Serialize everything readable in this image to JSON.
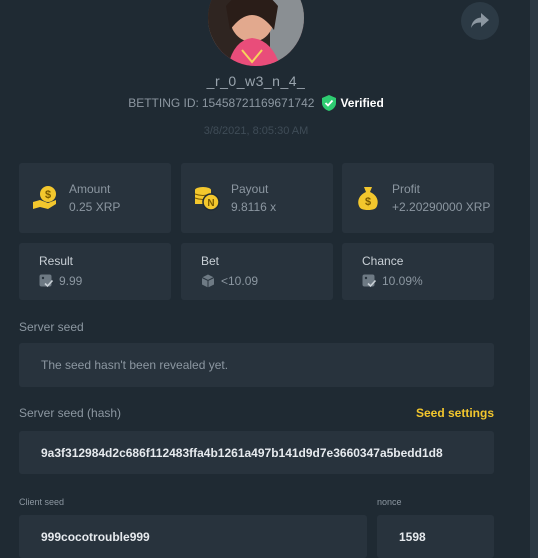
{
  "profile": {
    "username": "_r_0_w3_n_4_",
    "bet_id_label": "BETTING ID:",
    "bet_id": "15458721169671742",
    "verified_label": "Verified",
    "date": "3/8/2021, 8:05:30 AM"
  },
  "stats": [
    {
      "label": "Amount",
      "value": "0.25 XRP",
      "icon": "coin-hand-icon"
    },
    {
      "label": "Payout",
      "value": "9.8116 x",
      "icon": "coin-stack-icon"
    },
    {
      "label": "Profit",
      "value": "+2.20290000 XRP",
      "icon": "money-bag-icon"
    }
  ],
  "details": [
    {
      "label": "Result",
      "value": "9.99",
      "icon": "dice-check-icon"
    },
    {
      "label": "Bet",
      "value": "<10.09",
      "icon": "dice-icon"
    },
    {
      "label": "Chance",
      "value": "10.09%",
      "icon": "dice-check-icon"
    }
  ],
  "server_seed": {
    "label": "Server seed",
    "message": "The seed hasn't been revealed yet."
  },
  "server_seed_hash": {
    "label": "Server seed (hash)",
    "settings_label": "Seed settings",
    "value": "9a3f312984d2c686f112483ffa4b1261a497b141d9d7e3660347a5bedd1d8"
  },
  "client": {
    "seed_label": "Client seed",
    "seed_value": "999cocotrouble999",
    "nonce_label": "nonce",
    "nonce_value": "1598"
  },
  "colors": {
    "background": "#1f2a33",
    "card": "#28333d",
    "accent": "#f3c72d",
    "verified": "#2ecc71"
  }
}
